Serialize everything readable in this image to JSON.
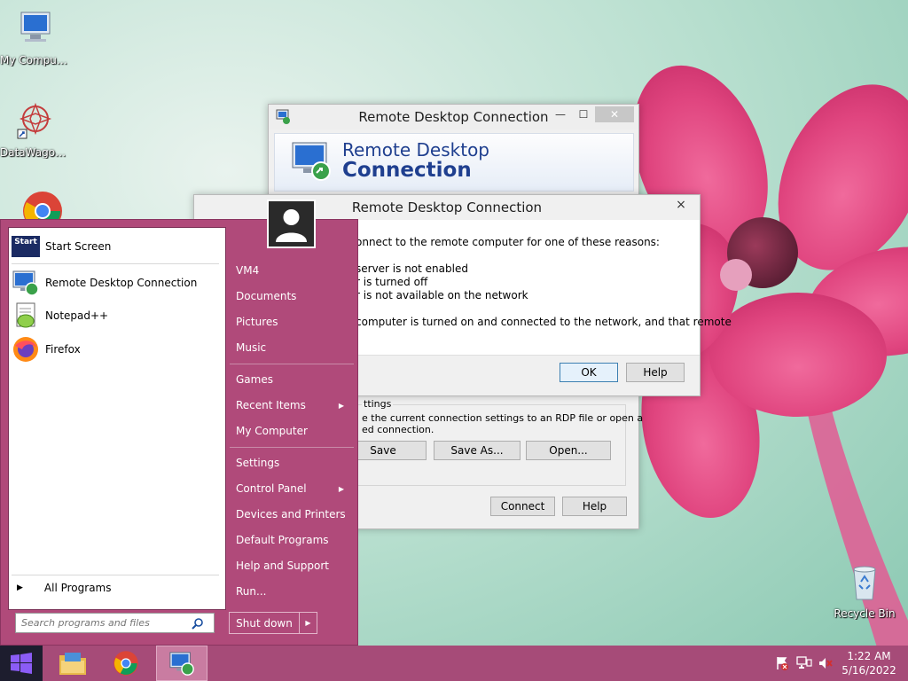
{
  "desktop": {
    "icons": [
      {
        "label": "My Computer",
        "icon": "my-computer-icon"
      },
      {
        "label": "DataWagon...",
        "icon": "datawagon-icon"
      },
      {
        "label": "Recycle Bin",
        "icon": "recycle-bin-icon"
      }
    ]
  },
  "rdc_window": {
    "title": "Remote Desktop Connection",
    "header_line1": "Remote Desktop",
    "header_line2": "Connection",
    "group_label": "ttings",
    "group_text_line1": "e the current connection settings to an RDP file or open a",
    "group_text_line2": "ed connection.",
    "save_button": "Save",
    "save_as_button": "Save As...",
    "open_button": "Open...",
    "connect_button": "Connect",
    "help_button": "Help"
  },
  "error_dialog": {
    "title": "Remote Desktop Connection",
    "line1": "onnect to the remote computer for one of these reasons:",
    "reason1": "server is not enabled",
    "reason2": "r is turned off",
    "reason3": "r is not available on the network",
    "line2": "computer is turned on and connected to the network, and that remote",
    "ok_button": "OK",
    "help_button": "Help",
    "close_glyph": "×"
  },
  "start_menu": {
    "pinned": [
      {
        "label": "Start Screen",
        "icon": "start-screen-icon"
      },
      {
        "label": "Remote Desktop Connection",
        "icon": "remote-desktop-icon"
      },
      {
        "label": "Notepad++",
        "icon": "notepad-plus-icon"
      },
      {
        "label": "Firefox",
        "icon": "firefox-icon"
      }
    ],
    "start_screen_badge": "Start",
    "all_programs": "All Programs",
    "search_placeholder": "Search programs and files",
    "right_items": [
      {
        "label": "VM4"
      },
      {
        "label": "Documents"
      },
      {
        "label": "Pictures"
      },
      {
        "label": "Music"
      },
      {
        "label": "Games"
      },
      {
        "label": "Recent Items"
      },
      {
        "label": "My Computer"
      },
      {
        "label": "Settings"
      },
      {
        "label": "Control Panel"
      },
      {
        "label": "Devices and Printers"
      },
      {
        "label": "Default Programs"
      },
      {
        "label": "Help and Support"
      },
      {
        "label": "Run..."
      }
    ],
    "shut_down": "Shut down"
  },
  "taskbar": {
    "time": "1:22 AM",
    "date": "5/16/2022",
    "pinned": [
      "file-explorer-icon",
      "chrome-icon",
      "remote-desktop-icon"
    ]
  },
  "colors": {
    "start_menu_bg": "#b04a7a",
    "taskbar_bg": "#a64b78",
    "rdc_header_blue": "#1f3f8f",
    "wallpaper_mint": "#a6d4c3",
    "flower_pink": "#e0457f"
  }
}
